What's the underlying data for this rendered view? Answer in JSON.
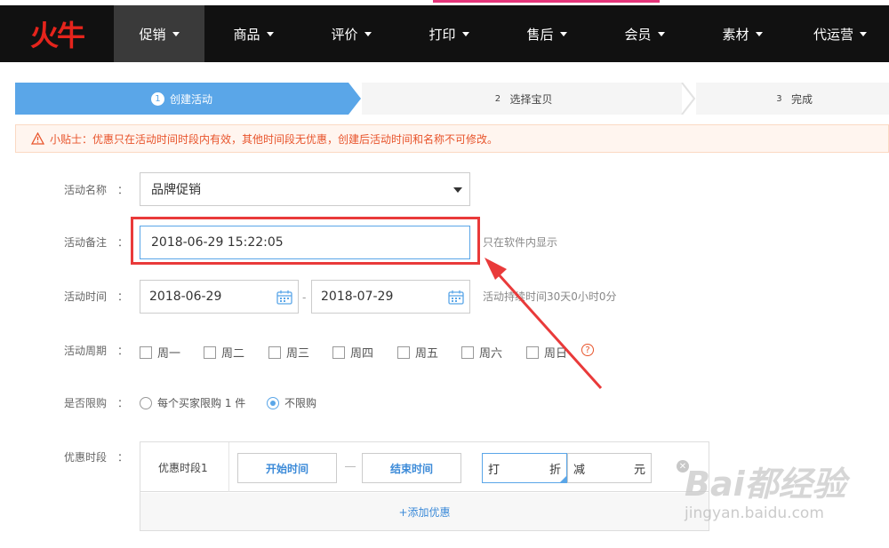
{
  "nav": {
    "logo": "火牛",
    "items": [
      {
        "label": "促销",
        "active": true
      },
      {
        "label": "商品"
      },
      {
        "label": "评价"
      },
      {
        "label": "打印"
      },
      {
        "label": "售后"
      },
      {
        "label": "会员"
      },
      {
        "label": "素材"
      },
      {
        "label": "代运营"
      }
    ]
  },
  "steps": [
    {
      "num": "1",
      "label": "创建活动"
    },
    {
      "num": "2",
      "label": "选择宝贝"
    },
    {
      "num": "3",
      "label": "完成"
    }
  ],
  "tip": "小贴士：优惠只在活动时间时段内有效，其他时间段无优惠，创建后活动时间和名称不可修改。",
  "form": {
    "colon": "：",
    "name_label": "活动名称",
    "name_value": "品牌促销",
    "note_label": "活动备注",
    "note_value": "2018-06-29 15:22:05",
    "note_hint": "只在软件内显示",
    "time_label": "活动时间",
    "start_date": "2018-06-29",
    "end_date": "2018-07-29",
    "duration_hint": "活动持续时间30天0小时0分",
    "cycle_label": "活动周期",
    "weekdays": [
      "周一",
      "周二",
      "周三",
      "周四",
      "周五",
      "周六",
      "周日"
    ],
    "help_mark": "?",
    "limit_label": "是否限购",
    "limit_options": [
      "每个买家限购 1 件",
      "不限购"
    ],
    "segment_label": "优惠时段",
    "segment_name": "优惠时段1",
    "start_time_btn": "开始时间",
    "end_time_btn": "结束时间",
    "discount_prefix": "打",
    "discount_suffix": "折",
    "minus_prefix": "减",
    "minus_suffix": "元",
    "add_discount": "+添加优惠"
  },
  "watermark": {
    "main": "Bai都经验",
    "sub": "jingyan.baidu.com"
  },
  "colors": {
    "accent": "#5aa6e8",
    "warn": "#e8542b",
    "highlight": "#e93a3a",
    "nav_bg": "#111111"
  }
}
